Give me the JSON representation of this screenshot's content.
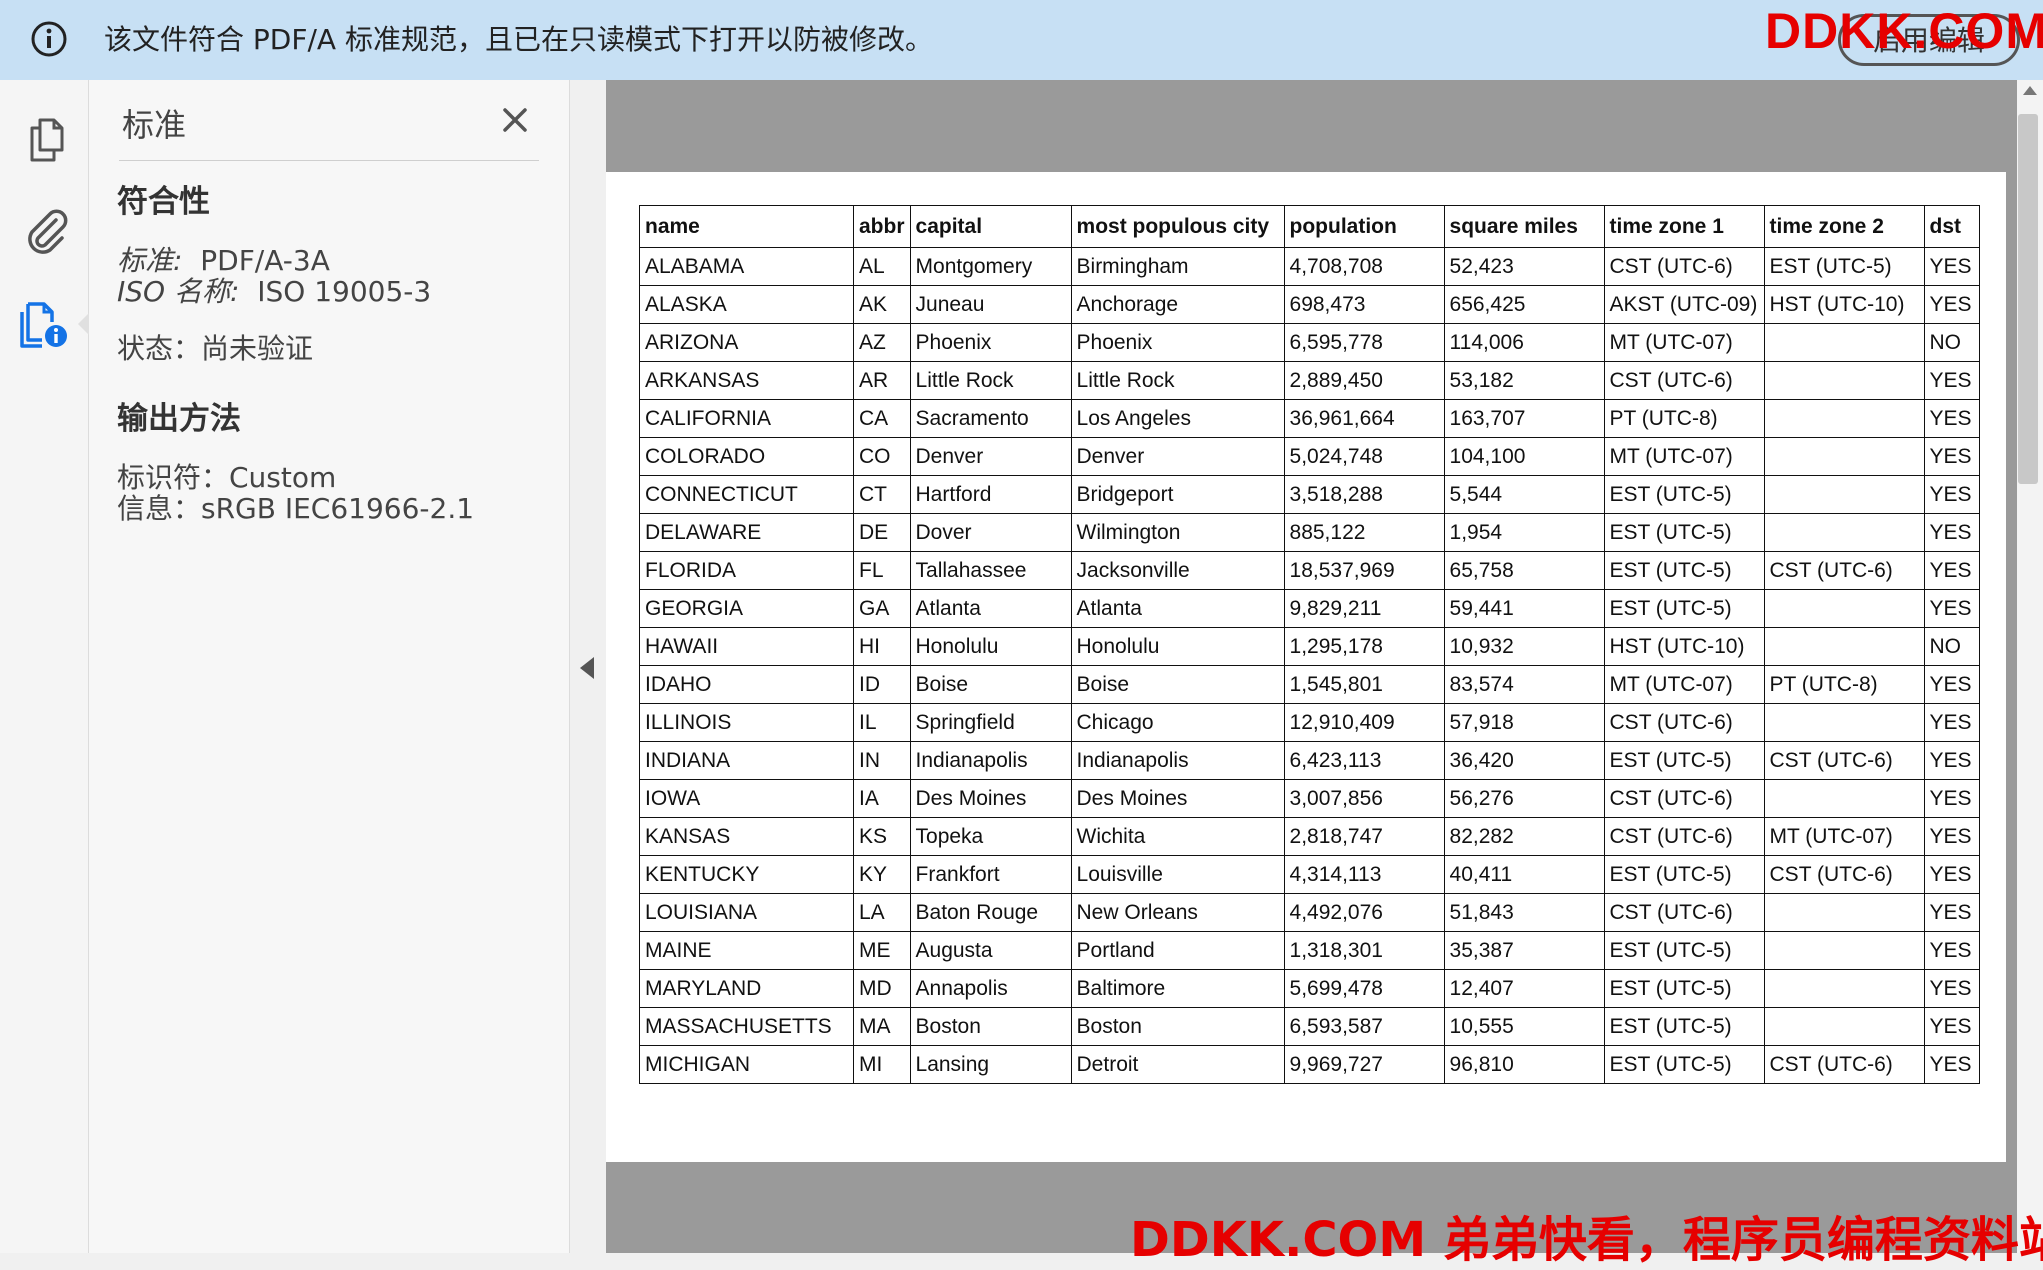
{
  "banner": {
    "message": "该文件符合 PDF/A 标准规范，且已在只读模式下打开以防被修改。",
    "enable_button": "启用编辑"
  },
  "watermark": {
    "top": "DDKK.COM",
    "bottom": "DDKK.COM 弟弟快看，程序员编程资料站"
  },
  "leftrail": {
    "icons": [
      "pages-icon",
      "attachment-icon",
      "standards-icon"
    ]
  },
  "panel": {
    "title": "标准",
    "conformance_heading": "符合性",
    "standard_label": "标准:",
    "standard_value": "PDF/A-3A",
    "iso_label": "ISO 名称:",
    "iso_value": "ISO 19005-3",
    "status_text": "状态：尚未验证",
    "output_heading": "输出方法",
    "identifier_text": "标识符：Custom",
    "info_text": "信息：sRGB IEC61966-2.1"
  },
  "table": {
    "headers": [
      "name",
      "abbr",
      "capital",
      "most populous city",
      "population",
      "square miles",
      "time zone 1",
      "time zone 2",
      "dst"
    ],
    "rows": [
      [
        "ALABAMA",
        "AL",
        "Montgomery",
        "Birmingham",
        "4,708,708",
        "52,423",
        "CST (UTC-6)",
        "EST (UTC-5)",
        "YES"
      ],
      [
        "ALASKA",
        "AK",
        "Juneau",
        "Anchorage",
        "698,473",
        "656,425",
        "AKST (UTC-09)",
        "HST (UTC-10)",
        "YES"
      ],
      [
        "ARIZONA",
        "AZ",
        "Phoenix",
        "Phoenix",
        "6,595,778",
        "114,006",
        "MT (UTC-07)",
        "",
        "NO"
      ],
      [
        "ARKANSAS",
        "AR",
        "Little Rock",
        "Little Rock",
        "2,889,450",
        "53,182",
        "CST (UTC-6)",
        "",
        "YES"
      ],
      [
        "CALIFORNIA",
        "CA",
        "Sacramento",
        "Los Angeles",
        "36,961,664",
        "163,707",
        "PT (UTC-8)",
        "",
        "YES"
      ],
      [
        "COLORADO",
        "CO",
        "Denver",
        "Denver",
        "5,024,748",
        "104,100",
        "MT (UTC-07)",
        "",
        "YES"
      ],
      [
        "CONNECTICUT",
        "CT",
        "Hartford",
        "Bridgeport",
        "3,518,288",
        "5,544",
        "EST (UTC-5)",
        "",
        "YES"
      ],
      [
        "DELAWARE",
        "DE",
        "Dover",
        "Wilmington",
        "885,122",
        "1,954",
        "EST (UTC-5)",
        "",
        "YES"
      ],
      [
        "FLORIDA",
        "FL",
        "Tallahassee",
        "Jacksonville",
        "18,537,969",
        "65,758",
        "EST (UTC-5)",
        "CST (UTC-6)",
        "YES"
      ],
      [
        "GEORGIA",
        "GA",
        "Atlanta",
        "Atlanta",
        "9,829,211",
        "59,441",
        "EST (UTC-5)",
        "",
        "YES"
      ],
      [
        "HAWAII",
        "HI",
        "Honolulu",
        "Honolulu",
        "1,295,178",
        "10,932",
        "HST (UTC-10)",
        "",
        "NO"
      ],
      [
        "IDAHO",
        "ID",
        "Boise",
        "Boise",
        "1,545,801",
        "83,574",
        "MT (UTC-07)",
        "PT (UTC-8)",
        "YES"
      ],
      [
        "ILLINOIS",
        "IL",
        "Springfield",
        "Chicago",
        "12,910,409",
        "57,918",
        "CST (UTC-6)",
        "",
        "YES"
      ],
      [
        "INDIANA",
        "IN",
        "Indianapolis",
        "Indianapolis",
        "6,423,113",
        "36,420",
        "EST (UTC-5)",
        "CST (UTC-6)",
        "YES"
      ],
      [
        "IOWA",
        "IA",
        "Des Moines",
        "Des Moines",
        "3,007,856",
        "56,276",
        "CST (UTC-6)",
        "",
        "YES"
      ],
      [
        "KANSAS",
        "KS",
        "Topeka",
        "Wichita",
        "2,818,747",
        "82,282",
        "CST (UTC-6)",
        "MT (UTC-07)",
        "YES"
      ],
      [
        "KENTUCKY",
        "KY",
        "Frankfort",
        "Louisville",
        "4,314,113",
        "40,411",
        "EST (UTC-5)",
        "CST (UTC-6)",
        "YES"
      ],
      [
        "LOUISIANA",
        "LA",
        "Baton Rouge",
        "New Orleans",
        "4,492,076",
        "51,843",
        "CST (UTC-6)",
        "",
        "YES"
      ],
      [
        "MAINE",
        "ME",
        "Augusta",
        "Portland",
        "1,318,301",
        "35,387",
        "EST (UTC-5)",
        "",
        "YES"
      ],
      [
        "MARYLAND",
        "MD",
        "Annapolis",
        "Baltimore",
        "5,699,478",
        "12,407",
        "EST (UTC-5)",
        "",
        "YES"
      ],
      [
        "MASSACHUSETTS",
        "MA",
        "Boston",
        "Boston",
        "6,593,587",
        "10,555",
        "EST (UTC-5)",
        "",
        "YES"
      ],
      [
        "MICHIGAN",
        "MI",
        "Lansing",
        "Detroit",
        "9,969,727",
        "96,810",
        "EST (UTC-5)",
        "CST (UTC-6)",
        "YES"
      ]
    ]
  },
  "colors": {
    "banner_bg": "#c7e0f4",
    "watermark": "#e60000",
    "active_icon": "#1473e6"
  }
}
